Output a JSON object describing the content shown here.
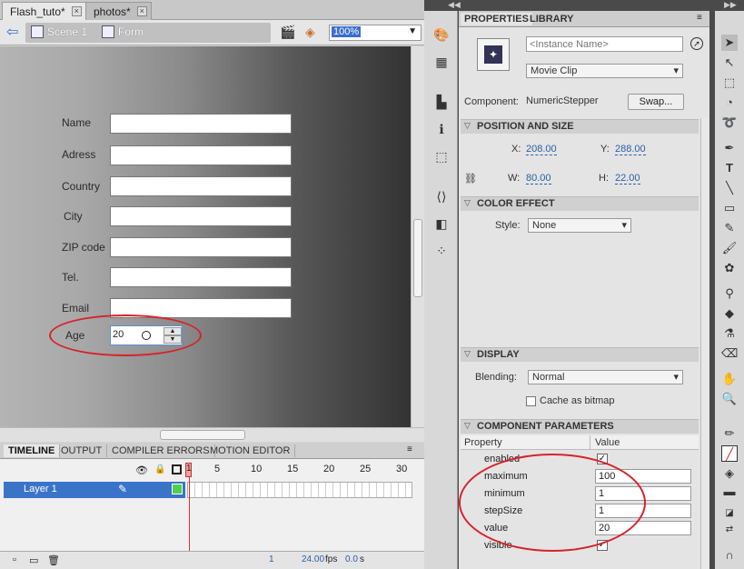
{
  "doc_tabs": [
    {
      "label": "Flash_tuto*"
    },
    {
      "label": "photos*"
    }
  ],
  "editbar": {
    "scene": "Scene 1",
    "symbol": "Form",
    "zoom": "100%"
  },
  "form": {
    "fields": [
      {
        "label": "Name"
      },
      {
        "label": "Adress"
      },
      {
        "label": "Country"
      },
      {
        "label": "City"
      },
      {
        "label": "ZIP code"
      },
      {
        "label": "Tel."
      },
      {
        "label": "Email"
      }
    ],
    "age_label": "Age",
    "age_value": "20"
  },
  "timeline": {
    "tabs": [
      "TIMELINE",
      "OUTPUT",
      "COMPILER ERRORS",
      "MOTION EDITOR"
    ],
    "frame_numbers": [
      "1",
      "5",
      "10",
      "15",
      "20",
      "25",
      "30"
    ],
    "layer_name": "Layer 1",
    "current_frame": "1",
    "fps": "24.00",
    "fps_unit": "fps",
    "time": "0.0",
    "time_unit": "s"
  },
  "properties": {
    "tabs": [
      "PROPERTIES",
      "LIBRARY"
    ],
    "instance_name_placeholder": "<Instance Name>",
    "symbol_type": "Movie Clip",
    "component_label": "Component:",
    "component_name": "NumericStepper",
    "swap_label": "Swap...",
    "position_size": {
      "title": "POSITION AND SIZE",
      "x_label": "X:",
      "x": "208.00",
      "y_label": "Y:",
      "y": "288.00",
      "w_label": "W:",
      "w": "80.00",
      "h_label": "H:",
      "h": "22.00"
    },
    "color_effect": {
      "title": "COLOR EFFECT",
      "style_label": "Style:",
      "style": "None"
    },
    "display": {
      "title": "DISPLAY",
      "blending_label": "Blending:",
      "blending": "Normal",
      "cache_label": "Cache as bitmap"
    },
    "component_parameters": {
      "title": "COMPONENT PARAMETERS",
      "col_property": "Property",
      "col_value": "Value",
      "rows": [
        {
          "name": "enabled",
          "checked": true
        },
        {
          "name": "maximum",
          "value": "100"
        },
        {
          "name": "minimum",
          "value": "1"
        },
        {
          "name": "stepSize",
          "value": "1"
        },
        {
          "name": "value",
          "value": "20"
        },
        {
          "name": "visible",
          "checked": true
        }
      ]
    }
  },
  "colors": {
    "accent": "#3a74c9",
    "highlight_ellipse": "#d6232a"
  }
}
